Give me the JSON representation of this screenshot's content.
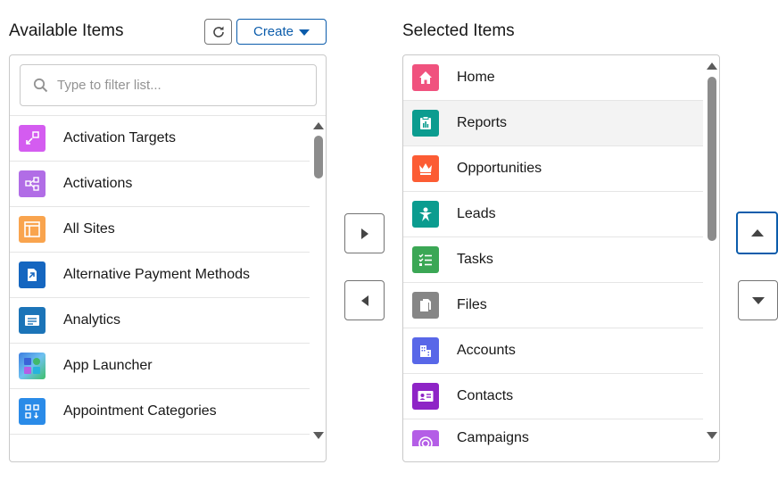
{
  "available": {
    "title": "Available Items",
    "refresh_icon": "refresh-icon",
    "create_label": "Create",
    "filter_placeholder": "Type to filter list...",
    "items": [
      {
        "label": "Activation Targets",
        "icon": "activation-targets-icon",
        "color": "#d45cf0"
      },
      {
        "label": "Activations",
        "icon": "activations-icon",
        "color": "#b16de6"
      },
      {
        "label": "All Sites",
        "icon": "all-sites-icon",
        "color": "#f9a44e"
      },
      {
        "label": "Alternative Payment Methods",
        "icon": "payment-methods-icon",
        "color": "#1566c0"
      },
      {
        "label": "Analytics",
        "icon": "analytics-icon",
        "color": "#1b74b8"
      },
      {
        "label": "App Launcher",
        "icon": "app-launcher-icon",
        "color": "#5a9ad8"
      },
      {
        "label": "Appointment Categories",
        "icon": "appointment-categories-icon",
        "color": "#2a8be8"
      }
    ]
  },
  "selected": {
    "title": "Selected Items",
    "items": [
      {
        "label": "Home",
        "icon": "home-icon",
        "color": "#f0527e"
      },
      {
        "label": "Reports",
        "icon": "reports-icon",
        "color": "#0b9c8f"
      },
      {
        "label": "Opportunities",
        "icon": "opportunities-icon",
        "color": "#fc5c34"
      },
      {
        "label": "Leads",
        "icon": "leads-icon",
        "color": "#0b9c8f"
      },
      {
        "label": "Tasks",
        "icon": "tasks-icon",
        "color": "#3ba755"
      },
      {
        "label": "Files",
        "icon": "files-icon",
        "color": "#868686"
      },
      {
        "label": "Accounts",
        "icon": "accounts-icon",
        "color": "#5867e8"
      },
      {
        "label": "Contacts",
        "icon": "contacts-icon",
        "color": "#8e24c6"
      },
      {
        "label": "Campaigns",
        "icon": "campaigns-icon",
        "color": "#b45ee6"
      }
    ]
  },
  "controls": {
    "move_right_icon": "move-right-icon",
    "move_left_icon": "move-left-icon",
    "move_up_icon": "move-up-icon",
    "move_down_icon": "move-down-icon"
  }
}
